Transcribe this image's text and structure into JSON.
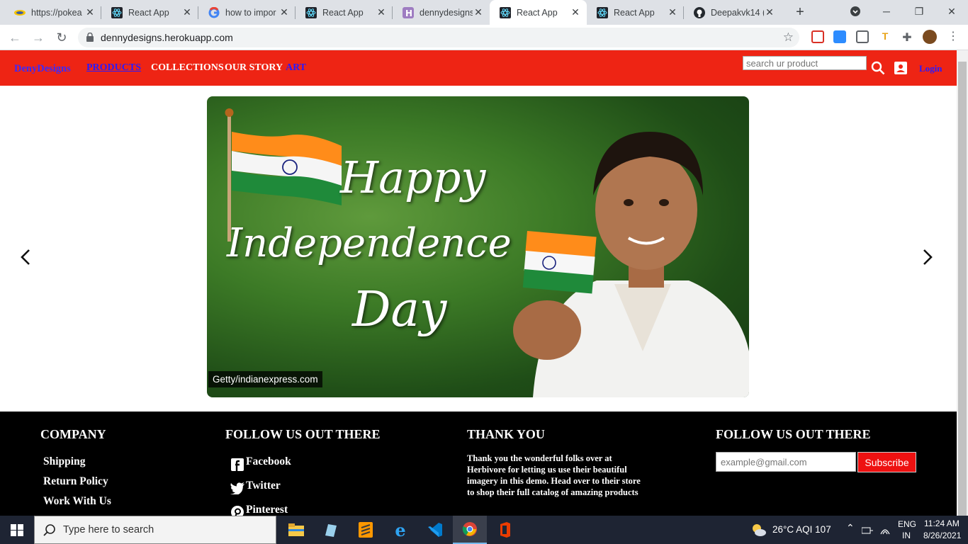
{
  "browser": {
    "tabs": [
      {
        "title": "https://pokea",
        "icon": "pokemon-icon"
      },
      {
        "title": "React App",
        "icon": "react-icon"
      },
      {
        "title": "how to impor",
        "icon": "google-icon"
      },
      {
        "title": "React App",
        "icon": "react-icon"
      },
      {
        "title": "dennydesigns",
        "icon": "heroku-icon"
      },
      {
        "title": "React App",
        "icon": "react-icon",
        "active": true
      },
      {
        "title": "React App",
        "icon": "react-icon"
      },
      {
        "title": "Deepakvk14 (",
        "icon": "github-icon"
      }
    ],
    "url": "dennydesigns.herokuapp.com"
  },
  "site": {
    "brand": "DenyDesigns",
    "nav": {
      "products": "PRODUCTS",
      "collections": "COLLECTIONS",
      "our_story": "OUR STORY",
      "art": "ART"
    },
    "search_placeholder": "search ur product",
    "login": "Login",
    "colors": {
      "navbar": "#ee2414",
      "link_blue": "#1a1aff",
      "footer": "#000000"
    }
  },
  "carousel": {
    "slide_text": {
      "happy": "Happy",
      "independence": "Independence",
      "day": "Day"
    },
    "caption": "Getty/indianexpress.com"
  },
  "footer": {
    "company": {
      "heading": "COMPANY",
      "links": [
        "Shipping",
        "Return Policy",
        "Work With Us"
      ]
    },
    "follow": {
      "heading": "FOLLOW US OUT THERE",
      "links": [
        "Facebook",
        "Twitter",
        "Pinterest"
      ]
    },
    "thanks": {
      "heading": "THANK YOU",
      "text": "Thank you the wonderful folks over at Herbivore for letting us use their beautiful imagery in this demo. Head over to their store to shop their full catalog of amazing products"
    },
    "newsletter": {
      "heading": "FOLLOW US OUT THERE",
      "email_placeholder": "example@gmail.com",
      "button": "Subscribe"
    }
  },
  "taskbar": {
    "search_placeholder": "Type here to search",
    "weather": "26°C  AQI 107",
    "language": [
      "ENG",
      "IN"
    ],
    "time": "11:24 AM",
    "date": "8/26/2021"
  }
}
